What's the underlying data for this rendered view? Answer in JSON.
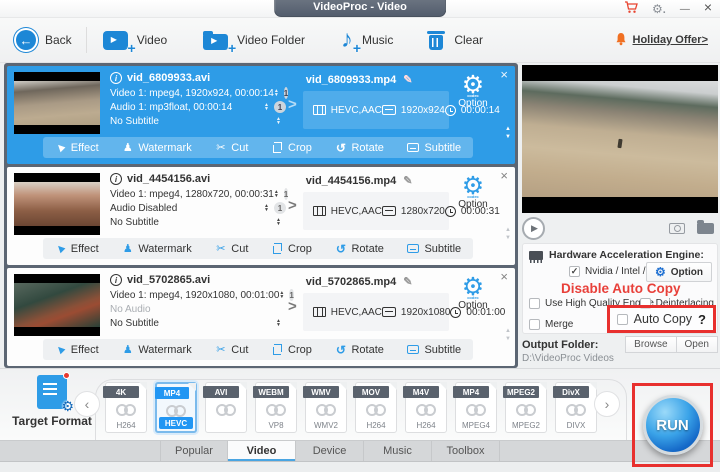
{
  "titlebar": {
    "title": "VideoProc - Video"
  },
  "toolbar": {
    "back_label": "Back",
    "video_label": "Video",
    "video_folder_label": "Video Folder",
    "music_label": "Music",
    "clear_label": "Clear",
    "offer_label": "Holiday Offer>"
  },
  "video_list": {
    "option_label": "Option",
    "codec_gear_label": "codec",
    "actions": [
      "Effect",
      "Watermark",
      "Cut",
      "Crop",
      "Rotate",
      "Subtitle"
    ],
    "items": [
      {
        "source_name": "vid_6809933.avi",
        "video_info": "Video 1: mpeg4, 1920x924, 00:00:14",
        "audio_info": "Audio 1: mp3float, 00:00:14",
        "subtitle_info": "No Subtitle",
        "video_track": "1",
        "audio_track": "1",
        "output_name": "vid_6809933.mp4",
        "codec": "HEVC,AAC",
        "resolution": "1920x924",
        "duration": "00:00:14"
      },
      {
        "source_name": "vid_4454156.avi",
        "video_info": "Video 1: mpeg4, 1280x720, 00:00:31",
        "audio_info": "Audio Disabled",
        "subtitle_info": "No Subtitle",
        "video_track": "1",
        "audio_track": "1",
        "output_name": "vid_4454156.mp4",
        "codec": "HEVC,AAC",
        "resolution": "1280x720",
        "duration": "00:00:31"
      },
      {
        "source_name": "vid_5702865.avi",
        "video_info": "Video 1: mpeg4, 1920x1080, 00:01:00",
        "audio_info": "No Audio",
        "subtitle_info": "No Subtitle",
        "video_track": "1",
        "output_name": "vid_5702865.mp4",
        "codec": "HEVC,AAC",
        "resolution": "1920x1080",
        "duration": "00:01:00"
      }
    ]
  },
  "hardware_panel": {
    "title": "Hardware Acceleration Engine:",
    "nvidia_label": "Nvidia / Intel / AMD",
    "option_label": "Option",
    "annotation": "Disable Auto Copy",
    "high_quality_label": "Use High Quality Engine",
    "deinterlacing_label": "Deinterlacing",
    "merge_label": "Merge",
    "auto_copy_label": "Auto Copy",
    "help_mark": "?"
  },
  "output_folder": {
    "label": "Output Folder:",
    "browse_label": "Browse",
    "open_label": "Open",
    "path": "D:\\VideoProc Videos"
  },
  "format_bar": {
    "target_format_label": "Target Format",
    "run_label": "RUN",
    "formats": [
      {
        "badge": "4K",
        "codec": "H264"
      },
      {
        "badge": "MP4",
        "codec": "HEVC"
      },
      {
        "badge": "AVI",
        "codec": ""
      },
      {
        "badge": "WEBM",
        "codec": "VP8"
      },
      {
        "badge": "WMV",
        "codec": "WMV2"
      },
      {
        "badge": "MOV",
        "codec": "H264"
      },
      {
        "badge": "M4V",
        "codec": "H264"
      },
      {
        "badge": "MP4",
        "codec": "MPEG4"
      },
      {
        "badge": "MPEG2",
        "codec": "MPEG2"
      },
      {
        "badge": "DivX",
        "codec": "DIVX"
      }
    ]
  },
  "tabs": {
    "items": [
      "Popular",
      "Video",
      "Device",
      "Music",
      "Toolbox"
    ],
    "active": "Video"
  },
  "colors": {
    "accent_blue": "#2e9ce7",
    "toolbar_icon_blue": "#1d87d6",
    "annotation_red": "#e8302e",
    "offer_orange": "#f07023",
    "dark_panel": "#5c6673"
  }
}
